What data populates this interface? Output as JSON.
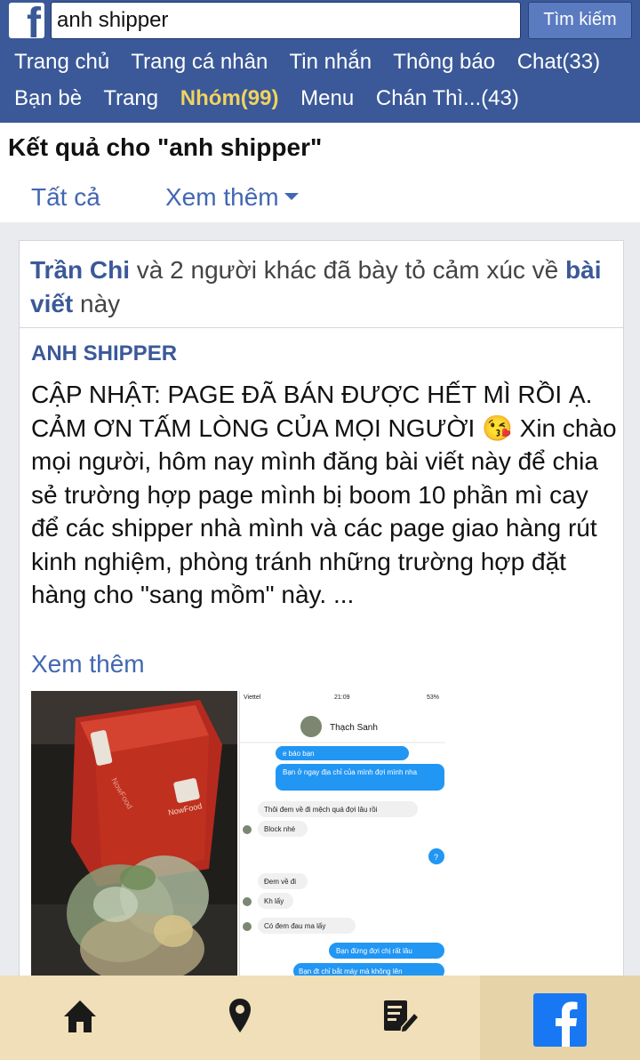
{
  "search": {
    "value": "anh shipper",
    "button_label": "Tìm kiếm"
  },
  "nav": {
    "row1": [
      "Trang chủ",
      "Trang cá nhân",
      "Tin nhắn",
      "Thông báo",
      "Chat(33)"
    ],
    "row2": [
      "Bạn bè",
      "Trang",
      "Nhóm(99)",
      "Menu",
      "Chán Thì...(43)"
    ]
  },
  "results": {
    "title": "Kết quả cho \"anh shipper\"",
    "tab_all": "Tất cả",
    "tab_more": "Xem thêm"
  },
  "post": {
    "reaction_name": "Trần Chi",
    "reaction_text": " và 2 người khác đã bày tỏ cảm xúc về ",
    "reaction_link": "bài viết",
    "reaction_tail": " này",
    "page_name": "ANH SHIPPER",
    "body": "CẬP NHẬT: PAGE ĐÃ BÁN ĐƯỢC HẾT MÌ RỒI Ạ. CẢM ƠN TẤM LÒNG CỦA MỌI NGƯỜI 😘 Xin chào mọi người, hôm nay mình đăng bài viết này để chia sẻ trường hợp page mình bị boom 10 phần mì cay để các shipper nhà mình và các page giao hàng rút kinh nghiệm, phòng tránh những trường hợp đặt hàng cho \"sang mồm\" này. ...",
    "see_more": "Xem thêm",
    "photo1": {
      "bag_text": "NowFood"
    },
    "photo2": {
      "carrier": "Viettel",
      "time": "21:09",
      "battery": "53%",
      "contact": "Thạch Sanh",
      "messages": [
        {
          "side": "right",
          "text": "e báo bạn"
        },
        {
          "side": "right",
          "text": "Bạn ở ngay địa chỉ của mình đợi mình nha"
        },
        {
          "side": "left",
          "text": "Thôi đem về đi mệch quá đợi lâu rồi"
        },
        {
          "side": "left",
          "text": "Block nhé"
        },
        {
          "side": "right",
          "text": "?"
        },
        {
          "side": "left",
          "text": "Đem về đi"
        },
        {
          "side": "left",
          "text": "Kh lấy"
        },
        {
          "side": "left",
          "text": "Có đem đau ma lấy"
        },
        {
          "side": "right",
          "text": "Bạn đừng đợi chị rất lâu"
        },
        {
          "side": "right",
          "text": "Bạn đt chỉ bắt máy mà không lên"
        }
      ]
    }
  },
  "bottom_nav": [
    "home-icon",
    "location-icon",
    "compose-icon",
    "facebook-icon"
  ],
  "colors": {
    "brand": "#3b5998",
    "link": "#4267b2",
    "highlight": "#f0d35e",
    "bottom_bar": "#f0dfb8",
    "messenger_blue": "#2196f3"
  }
}
